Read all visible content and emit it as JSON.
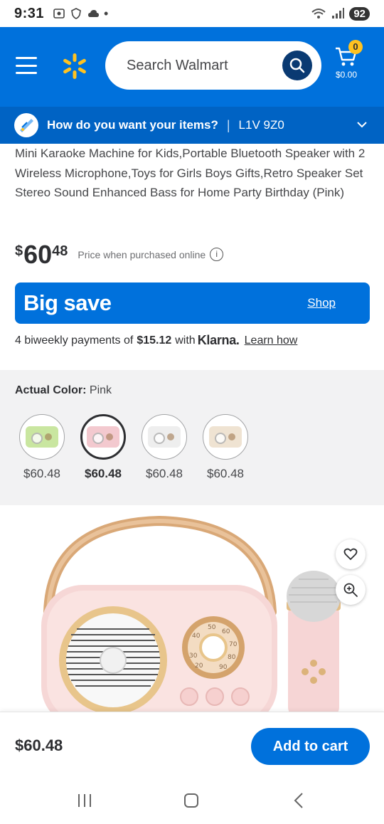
{
  "status_bar": {
    "time": "9:31",
    "battery": "92"
  },
  "header": {
    "search_placeholder": "Search Walmart",
    "cart_count": "0",
    "cart_total": "$0.00",
    "colors": {
      "brand_blue": "#0071dc",
      "spark_yellow": "#ffc220",
      "search_button": "#0a3a72"
    }
  },
  "delivery": {
    "question": "How do you want your items?",
    "separator": "|",
    "postal_code": "L1V 9Z0"
  },
  "product": {
    "title": "Mini Karaoke Machine for Kids,Portable Bluetooth Speaker with 2 Wireless Microphone,Toys for Girls Boys Gifts,Retro Speaker Set Stereo Sound Enhanced Bass for Home Party Birthday (Pink)",
    "price": {
      "currency": "$",
      "dollars": "60",
      "cents": "48",
      "note": "Price when purchased online",
      "info_icon": "i"
    }
  },
  "promo": {
    "title": "Big save",
    "link": "Shop"
  },
  "klarna": {
    "prefix": "4 biweekly payments of",
    "amount": "$15.12",
    "with": "with",
    "brand": "Klarna.",
    "link": "Learn how"
  },
  "color_options": {
    "label": "Actual Color:",
    "selected": "Pink",
    "swatches": [
      {
        "price": "$60.48",
        "tint": "#c9e6a0",
        "selected": false
      },
      {
        "price": "$60.48",
        "tint": "#f3c9cf",
        "selected": true
      },
      {
        "price": "$60.48",
        "tint": "#eeeeee",
        "selected": false
      },
      {
        "price": "$60.48",
        "tint": "#efe3d2",
        "selected": false
      }
    ]
  },
  "bottom_bar": {
    "price": "$60.48",
    "add_to_cart": "Add to cart"
  }
}
